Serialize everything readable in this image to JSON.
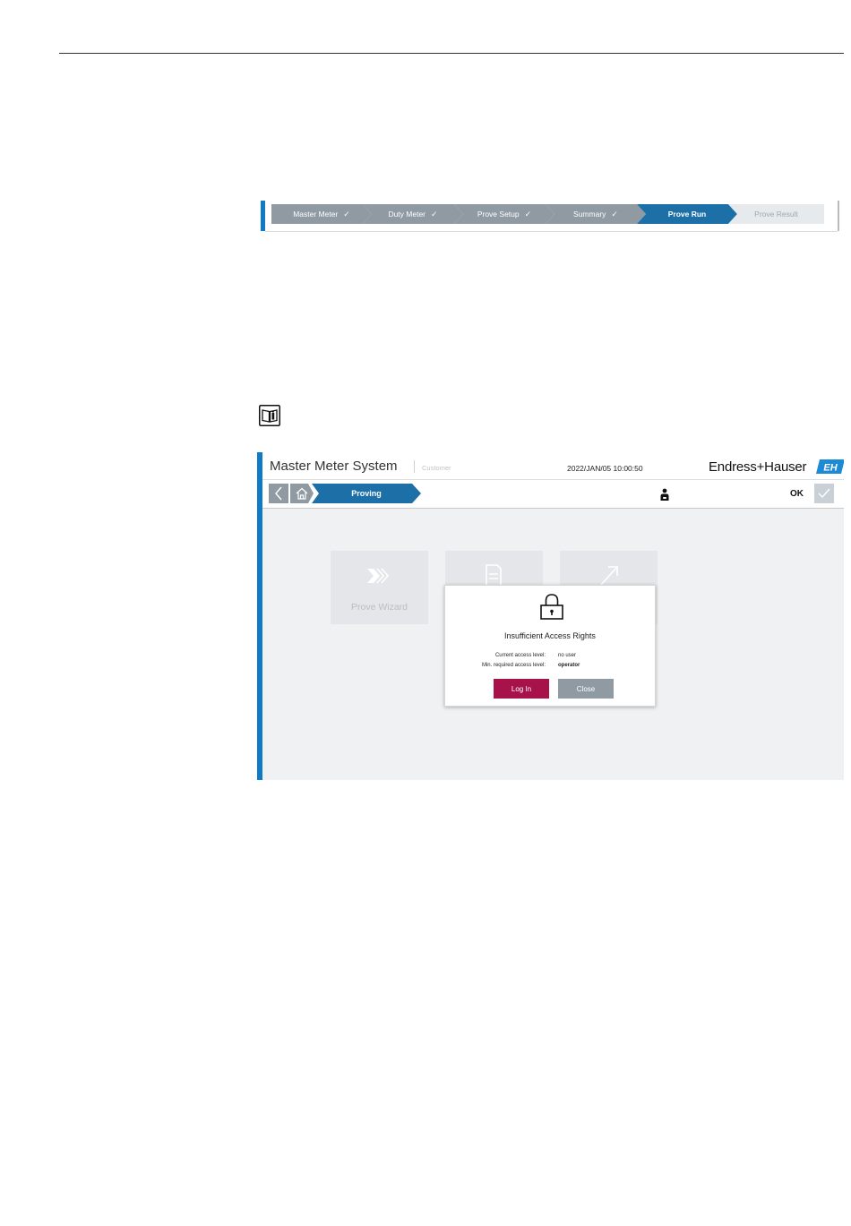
{
  "progress": {
    "steps": [
      {
        "label": "Master Meter",
        "state": "done"
      },
      {
        "label": "Duty Meter",
        "state": "done"
      },
      {
        "label": "Prove Setup",
        "state": "done"
      },
      {
        "label": "Summary",
        "state": "done"
      },
      {
        "label": "Prove Run",
        "state": "active"
      },
      {
        "label": "Prove Result",
        "state": "pending"
      }
    ],
    "check_glyph": "✓"
  },
  "screen": {
    "header": {
      "title": "Master Meter System",
      "subtitle": "Customer",
      "datetime": "2022/JAN/05 10:00:50",
      "brand": "Endress+Hauser",
      "logo_text": "E+H"
    },
    "nav": {
      "breadcrumb": "Proving",
      "ok_label": "OK"
    },
    "tiles": [
      {
        "label": "Prove Wizard",
        "icon": "chevrons-right-icon"
      },
      {
        "label": "",
        "icon": "document-icon"
      },
      {
        "label": "",
        "icon": "arrow-up-right-icon"
      }
    ],
    "dialog": {
      "title": "Insufficient Access Rights",
      "current_label": "Current access level:",
      "current_value": "no user",
      "required_label": "Min. required access level:",
      "required_value": "operator",
      "login_label": "Log In",
      "close_label": "Close"
    }
  },
  "colors": {
    "accent": "#0f7ac6",
    "active_step": "#1d6fa8",
    "done_step": "#8f9aa3",
    "login": "#a8124a"
  }
}
